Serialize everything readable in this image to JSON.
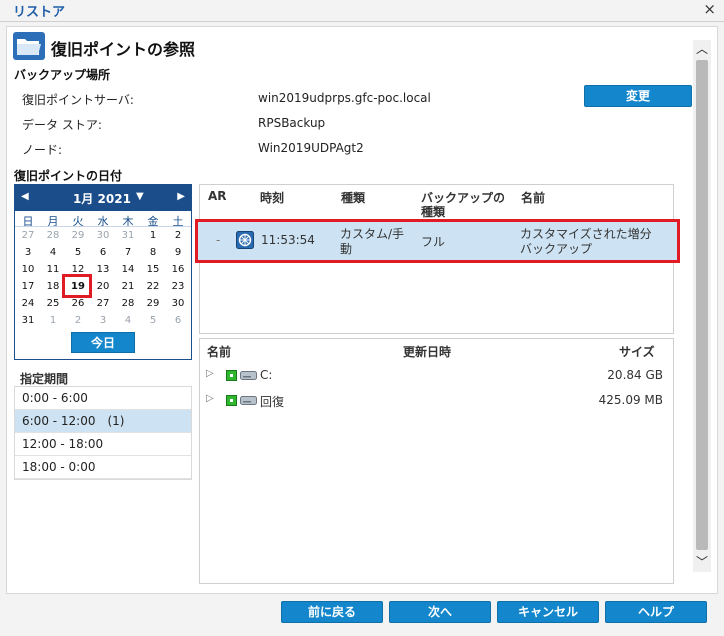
{
  "window": {
    "title": "リストア",
    "close_glyph": "×"
  },
  "page": {
    "heading": "復旧ポイントの参照"
  },
  "backup_location": {
    "section_title": "バックアップ場所",
    "fields": [
      {
        "label": "復旧ポイントサーバ:",
        "value": "win2019udprps.gfc-poc.local"
      },
      {
        "label": "データ ストア:",
        "value": "RPSBackup"
      },
      {
        "label": "ノード:",
        "value": "Win2019UDPAgt2"
      }
    ],
    "change_button": "変更"
  },
  "date_section": {
    "title": "復旧ポイントの日付"
  },
  "calendar": {
    "month_label": "1月 2021",
    "prev_glyph": "◀",
    "next_glyph": "▶",
    "drop_glyph": "▼",
    "weekdays": [
      "日",
      "月",
      "火",
      "水",
      "木",
      "金",
      "土"
    ],
    "weeks": [
      [
        "27",
        "28",
        "29",
        "30",
        "31",
        "1",
        "2"
      ],
      [
        "3",
        "4",
        "5",
        "6",
        "7",
        "8",
        "9"
      ],
      [
        "10",
        "11",
        "12",
        "13",
        "14",
        "15",
        "16"
      ],
      [
        "17",
        "18",
        "19",
        "20",
        "21",
        "22",
        "23"
      ],
      [
        "24",
        "25",
        "26",
        "27",
        "28",
        "29",
        "30"
      ],
      [
        "31",
        "1",
        "2",
        "3",
        "4",
        "5",
        "6"
      ]
    ],
    "selected_day": "19",
    "today_button": "今日"
  },
  "period": {
    "title": "指定期間",
    "items": [
      "0:00 - 6:00",
      "6:00 - 12:00　(1)",
      "12:00 - 18:00",
      "18:00 - 0:00"
    ],
    "selected_index": 1
  },
  "recovery_points": {
    "headers": {
      "ar": "AR",
      "time": "時刻",
      "type": "種類",
      "backup_type_l1": "バックアップの",
      "backup_type_l2": "種類",
      "name": "名前"
    },
    "rows": [
      {
        "ar": "-",
        "icon": "backup-wheel-icon",
        "time": "11:53:54",
        "type_l1": "カスタム/手",
        "type_l2": "動",
        "backup_type": "フル",
        "name_l1": "カスタマイズされた増分",
        "name_l2": "バックアップ"
      }
    ]
  },
  "files": {
    "headers": {
      "name": "名前",
      "modified": "更新日時",
      "size": "サイズ"
    },
    "rows": [
      {
        "expander": "▷",
        "icon": "drive-icon",
        "name": "C:",
        "size": "20.84 GB"
      },
      {
        "expander": "▷",
        "icon": "drive-icon",
        "name": "回復",
        "size": "425.09 MB"
      }
    ]
  },
  "scrollbar": {
    "up_glyph": "︿",
    "down_glyph": "﹀"
  },
  "footer": {
    "back": "前に戻る",
    "next": "次へ",
    "cancel": "キャンセル",
    "help": "ヘルプ"
  },
  "colors": {
    "accent": "#1487cc",
    "calendar_header": "#1b4d8a",
    "selection": "#cde3f3",
    "highlight_box": "#e01b24"
  }
}
